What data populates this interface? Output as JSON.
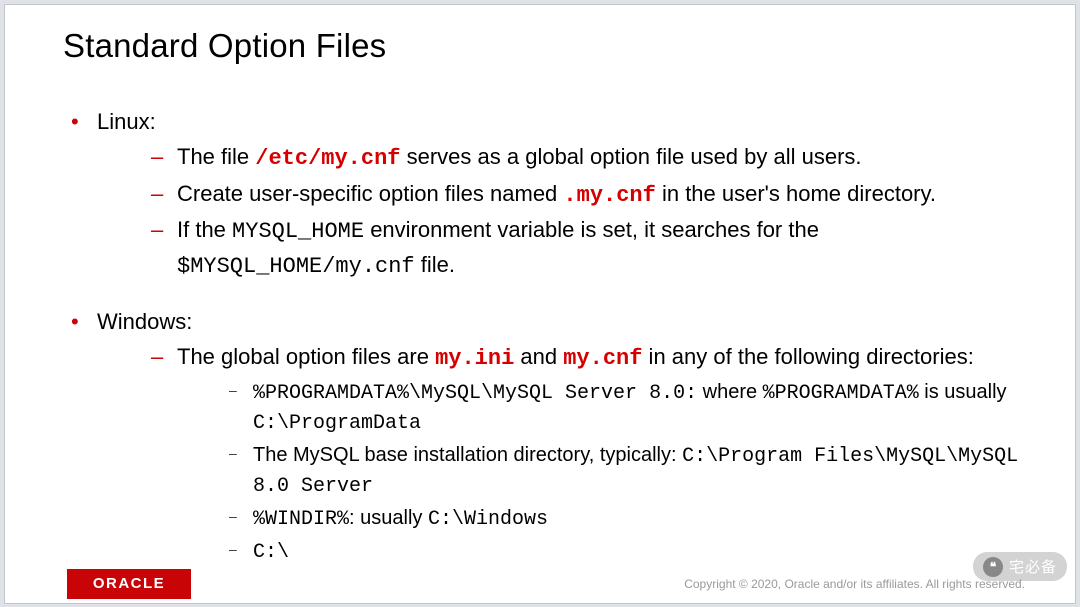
{
  "title": "Standard Option Files",
  "linux": {
    "heading": "Linux:",
    "b1_pre": "The file ",
    "b1_code": "/etc/my.cnf",
    "b1_post": " serves as a global option file used by all users.",
    "b2_pre": "Create user-specific option files named ",
    "b2_code": ".my.cnf",
    "b2_post": " in the user's home directory.",
    "b3_pre": "If the ",
    "b3_code1": "MYSQL_HOME",
    "b3_mid": " environment variable is set, it searches for the ",
    "b3_code2": "$MYSQL_HOME/my.cnf",
    "b3_post": " file."
  },
  "windows": {
    "heading": "Windows:",
    "b1_pre": "The global option files are ",
    "b1_code1": "my.ini",
    "b1_mid": " and ",
    "b1_code2": "my.cnf",
    "b1_post": " in any of the following directories:",
    "s1_code1": "%PROGRAMDATA%\\MySQL\\MySQL Server 8.0:",
    "s1_mid": " where ",
    "s1_code2": "%PROGRAMDATA%",
    "s1_mid2": " is usually ",
    "s1_code3": "C:\\ProgramData",
    "s2_pre": "The MySQL base installation directory, typically: ",
    "s2_code": "C:\\Program Files\\MySQL\\MySQL 8.0 Server",
    "s3_code1": "%WINDIR%",
    "s3_mid": ": usually ",
    "s3_code2": "C:\\Windows",
    "s4_code": "C:\\"
  },
  "footer": {
    "brand": "ORACLE",
    "copyright": "Copyright © 2020, Oracle and/or its affiliates. All rights reserved."
  },
  "watermark": {
    "icon": "❝",
    "text": "宅必备"
  }
}
